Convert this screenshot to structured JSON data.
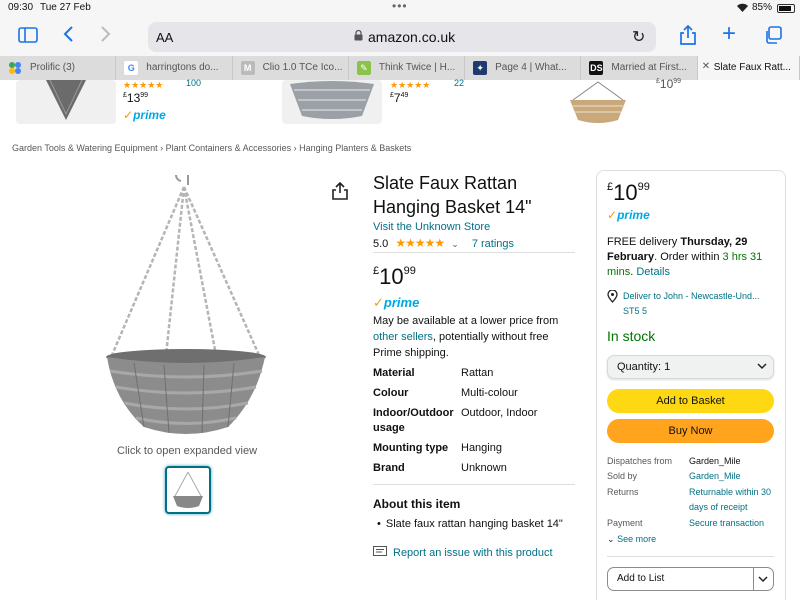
{
  "status": {
    "time": "09:30",
    "date": "Tue 27 Feb",
    "battery": "85%"
  },
  "toolbar": {
    "aa": "AA",
    "url": "amazon.co.uk"
  },
  "tabs": [
    {
      "label": "Prolific (3)"
    },
    {
      "label": "harringtons do..."
    },
    {
      "label": "Clio 1.0 TCe Ico..."
    },
    {
      "label": "Think Twice | H..."
    },
    {
      "label": "Page 4 | What..."
    },
    {
      "label": "Married at First..."
    },
    {
      "label": "Slate Faux Ratt..."
    }
  ],
  "carousel": {
    "price1": {
      "whole": "13",
      "frac": "99"
    },
    "price2": {
      "whole": "7",
      "frac": "49"
    },
    "rating_count_frag1": "100",
    "rating_count_frag2": "22",
    "price3_frag": "10",
    "prime": "prime"
  },
  "breadcrumb": [
    "Garden Tools & Watering Equipment",
    "Plant Containers & Accessories",
    "Hanging Planters & Baskets"
  ],
  "gallery": {
    "expand": "Click to open expanded view"
  },
  "product": {
    "title": "Slate Faux Rattan Hanging Basket 14\"",
    "store": "Visit the Unknown Store",
    "rating": "5.0",
    "ratings_count": "7 ratings",
    "currency": "£",
    "price_whole": "10",
    "price_frac": "99",
    "prime": "prime",
    "maybe_pre": "May be available at a lower price from ",
    "maybe_link": "other sellers",
    "maybe_post": ", potentially without free Prime shipping.",
    "specs": [
      {
        "k": "Material",
        "v": "Rattan"
      },
      {
        "k": "Colour",
        "v": "Multi-colour"
      },
      {
        "k": "Indoor/Outdoor usage",
        "v": "Outdoor, Indoor"
      },
      {
        "k": "Mounting type",
        "v": "Hanging"
      },
      {
        "k": "Brand",
        "v": "Unknown"
      }
    ],
    "about_title": "About this item",
    "about_items": [
      "Slate faux rattan hanging basket 14\""
    ],
    "report": "Report an issue with this product"
  },
  "buybox": {
    "currency": "£",
    "price_whole": "10",
    "price_frac": "99",
    "prime": "prime",
    "delivery_pre": "FREE delivery ",
    "delivery_date": "Thursday, 29 February",
    "order_within": ". Order within ",
    "countdown": "3 hrs 31 mins",
    "details": "Details",
    "deliver_to": "Deliver to John - Newcastle-Und... ST5 5",
    "stock": "In stock",
    "quantity_label": "Quantity:",
    "quantity_value": "1",
    "add_to_basket": "Add to Basket",
    "buy_now": "Buy Now",
    "dispatches_k": "Dispatches from",
    "dispatches_v": "Garden_Mile",
    "sold_k": "Sold by",
    "sold_v": "Garden_Mile",
    "returns_k": "Returns",
    "returns_v": "Returnable within 30 days of receipt",
    "payment_k": "Payment",
    "payment_v": "Secure transaction",
    "see_more": "See more",
    "add_to_list": "Add to List"
  }
}
